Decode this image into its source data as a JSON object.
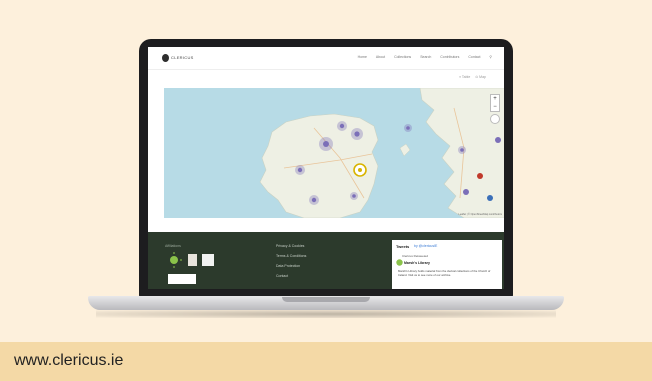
{
  "caption": "www.clericus.ie",
  "colors": {
    "background": "#fdf0dc",
    "caption_bar": "#f4d9a6",
    "footer": "#2c3a2c",
    "map_sea": "#b7dbe6",
    "map_land": "#eef0e4",
    "marker": "#7b6fb8",
    "marker_selected": "#d8b400"
  },
  "site": {
    "logo_text": "CLERICUS",
    "nav": [
      "Home",
      "About",
      "Collections",
      "Search",
      "Contributors",
      "Contact"
    ],
    "search_icon": "search-icon",
    "view_toggle": [
      "≡ Table",
      "⊙ Map"
    ],
    "map": {
      "zoom_in": "+",
      "zoom_out": "−",
      "attribution": "Leaflet | © OpenStreetMap contributors"
    },
    "footer": {
      "heading": "Affiliations",
      "links": [
        "Privacy & Cookies",
        "Terms & Conditions",
        "Data Protection",
        "Contact"
      ],
      "tweets": {
        "title": "Tweets",
        "handle": "by @clericusIE",
        "item_source": "Clericus Retweeted",
        "item_name": "Marsh's Library",
        "item_text": "Marsh's Library holds material from the clerical collections of the Church of Ireland. Visit us to see more of our archive."
      }
    }
  }
}
